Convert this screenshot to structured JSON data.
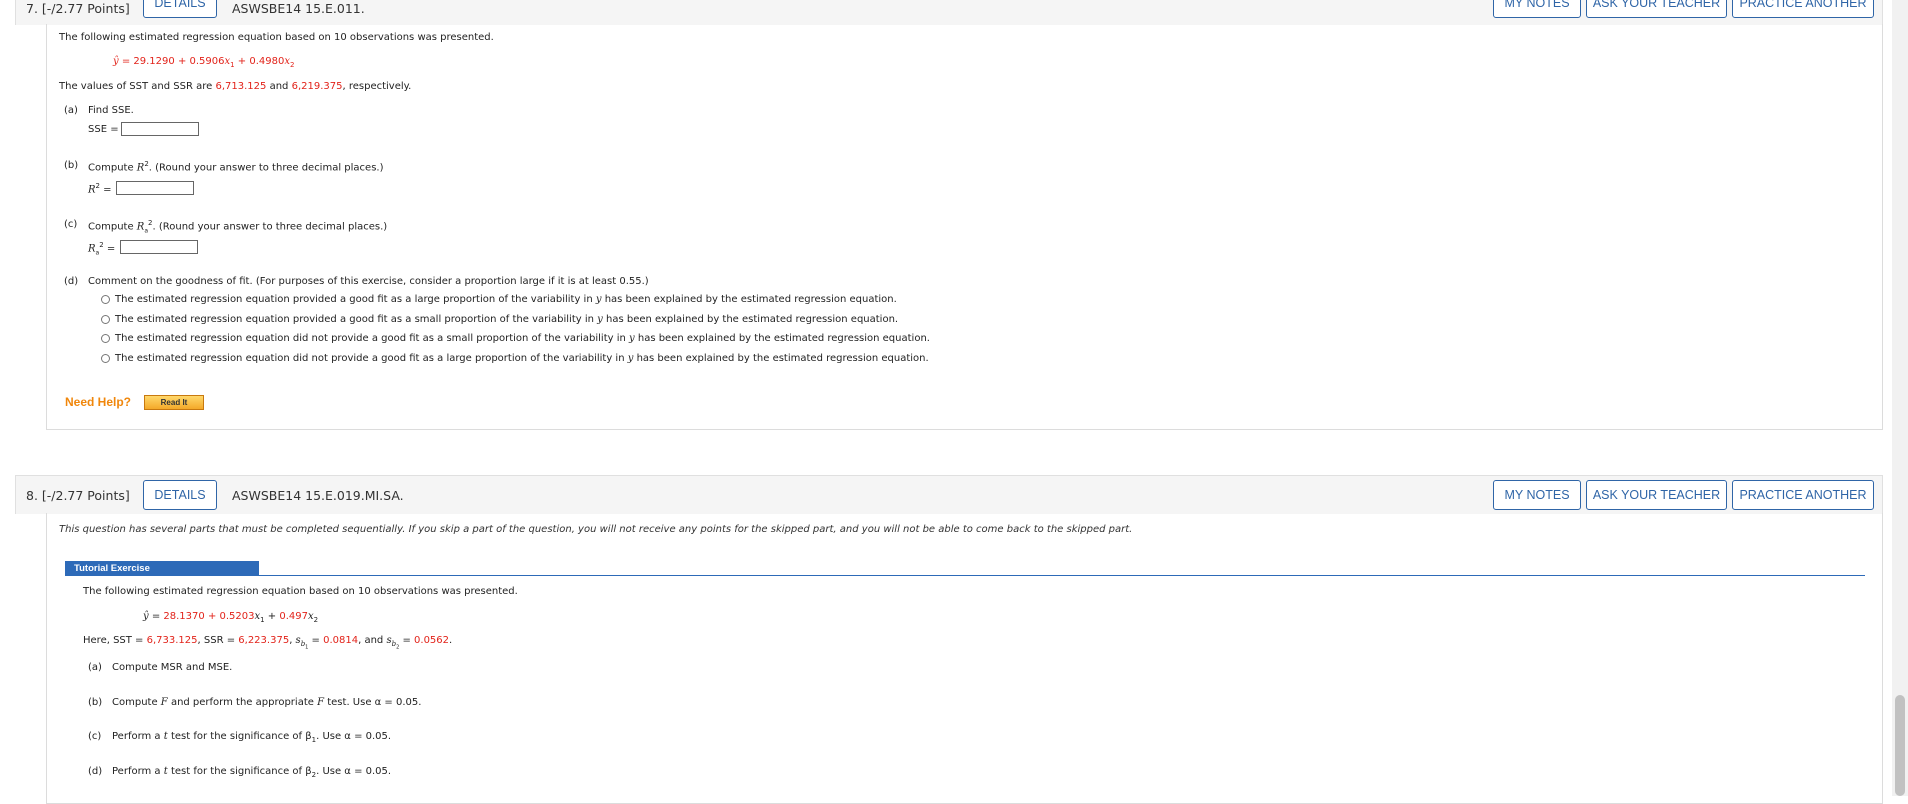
{
  "header_buttons": {
    "details": "DETAILS",
    "my_notes": "MY NOTES",
    "ask_teacher": "ASK YOUR TEACHER",
    "practice_another": "PRACTICE ANOTHER"
  },
  "q7": {
    "number": "7. [-/2.77 Points]",
    "code": "ASWSBE14 15.E.011.",
    "intro": "The following estimated regression equation based on 10 observations was presented.",
    "eq_yhat": "ŷ",
    "eq_b0": "29.1290",
    "eq_b1": "0.5906",
    "eq_b2": "0.4980",
    "sst_ssr_prefix": "The values of SST and SSR are",
    "sst": "6,713.125",
    "and_word": "and",
    "ssr": "6,219.375",
    "respectively": ", respectively.",
    "part_a_label": "(a)",
    "part_a_text": "Find SSE.",
    "sse_label": "SSE =",
    "part_b_label": "(b)",
    "part_b_prefix": "Compute",
    "part_b_suffix": ". (Round your answer to three decimal places.)",
    "r2_label": "R",
    "part_c_label": "(c)",
    "part_c_prefix": "Compute",
    "part_c_suffix": ". (Round your answer to three decimal places.)",
    "part_d_label": "(d)",
    "part_d_text": "Comment on the goodness of fit. (For purposes of this exercise, consider a proportion large if it is at least 0.55.)",
    "options": [
      {
        "pre": "The estimated regression equation provided a good fit as a large proportion of the variability in",
        "post": "has been explained by the estimated regression equation."
      },
      {
        "pre": "The estimated regression equation provided a good fit as a small proportion of the variability in",
        "post": "has been explained by the estimated regression equation."
      },
      {
        "pre": "The estimated regression equation did not provide a good fit as a small proportion of the variability in",
        "post": "has been explained by the estimated regression equation."
      },
      {
        "pre": "The estimated regression equation did not provide a good fit as a large proportion of the variability in",
        "post": "has been explained by the estimated regression equation."
      }
    ],
    "y_var": "y",
    "need_help": "Need Help?",
    "read_it": "Read It"
  },
  "q8": {
    "number": "8. [-/2.77 Points]",
    "code": "ASWSBE14 15.E.019.MI.SA.",
    "notice": "This question has several parts that must be completed sequentially. If you skip a part of the question, you will not receive any points for the skipped part, and you will not be able to come back to the skipped part.",
    "tutorial_tab": "Tutorial Exercise",
    "intro": "The following estimated regression equation based on 10 observations was presented.",
    "eq_b0": "28.1370",
    "eq_b1": "0.5203",
    "eq_b2": "0.497",
    "here_prefix": "Here, SST =",
    "sst": "6,733.125",
    "ssr_prefix": ", SSR =",
    "ssr": "6,223.375",
    "sb1": "0.0814",
    "and_word": ", and",
    "sb2": "0.0562",
    "part_a_label": "(a)",
    "part_a_text": "Compute MSR and MSE.",
    "part_b_label": "(b)",
    "part_b_pre": "Compute",
    "part_b_f1": "F",
    "part_b_mid": "and perform the appropriate",
    "part_b_f2": "F",
    "part_b_post": "test. Use α = 0.05.",
    "part_c_label": "(c)",
    "part_c_pre": "Perform a",
    "part_c_post": "test for the significance of β",
    "part_c_end": ". Use α = 0.05.",
    "part_d_label": "(d)",
    "part_d_pre": "Perform a",
    "part_d_post": "test for the significance of β",
    "part_d_end": ". Use α = 0.05.",
    "t_var": "t"
  },
  "colors": {
    "accent": "#2f65a7",
    "value_red": "#e2231a",
    "help_orange": "#f0870c",
    "tutorial_blue": "#2d6ab8"
  }
}
